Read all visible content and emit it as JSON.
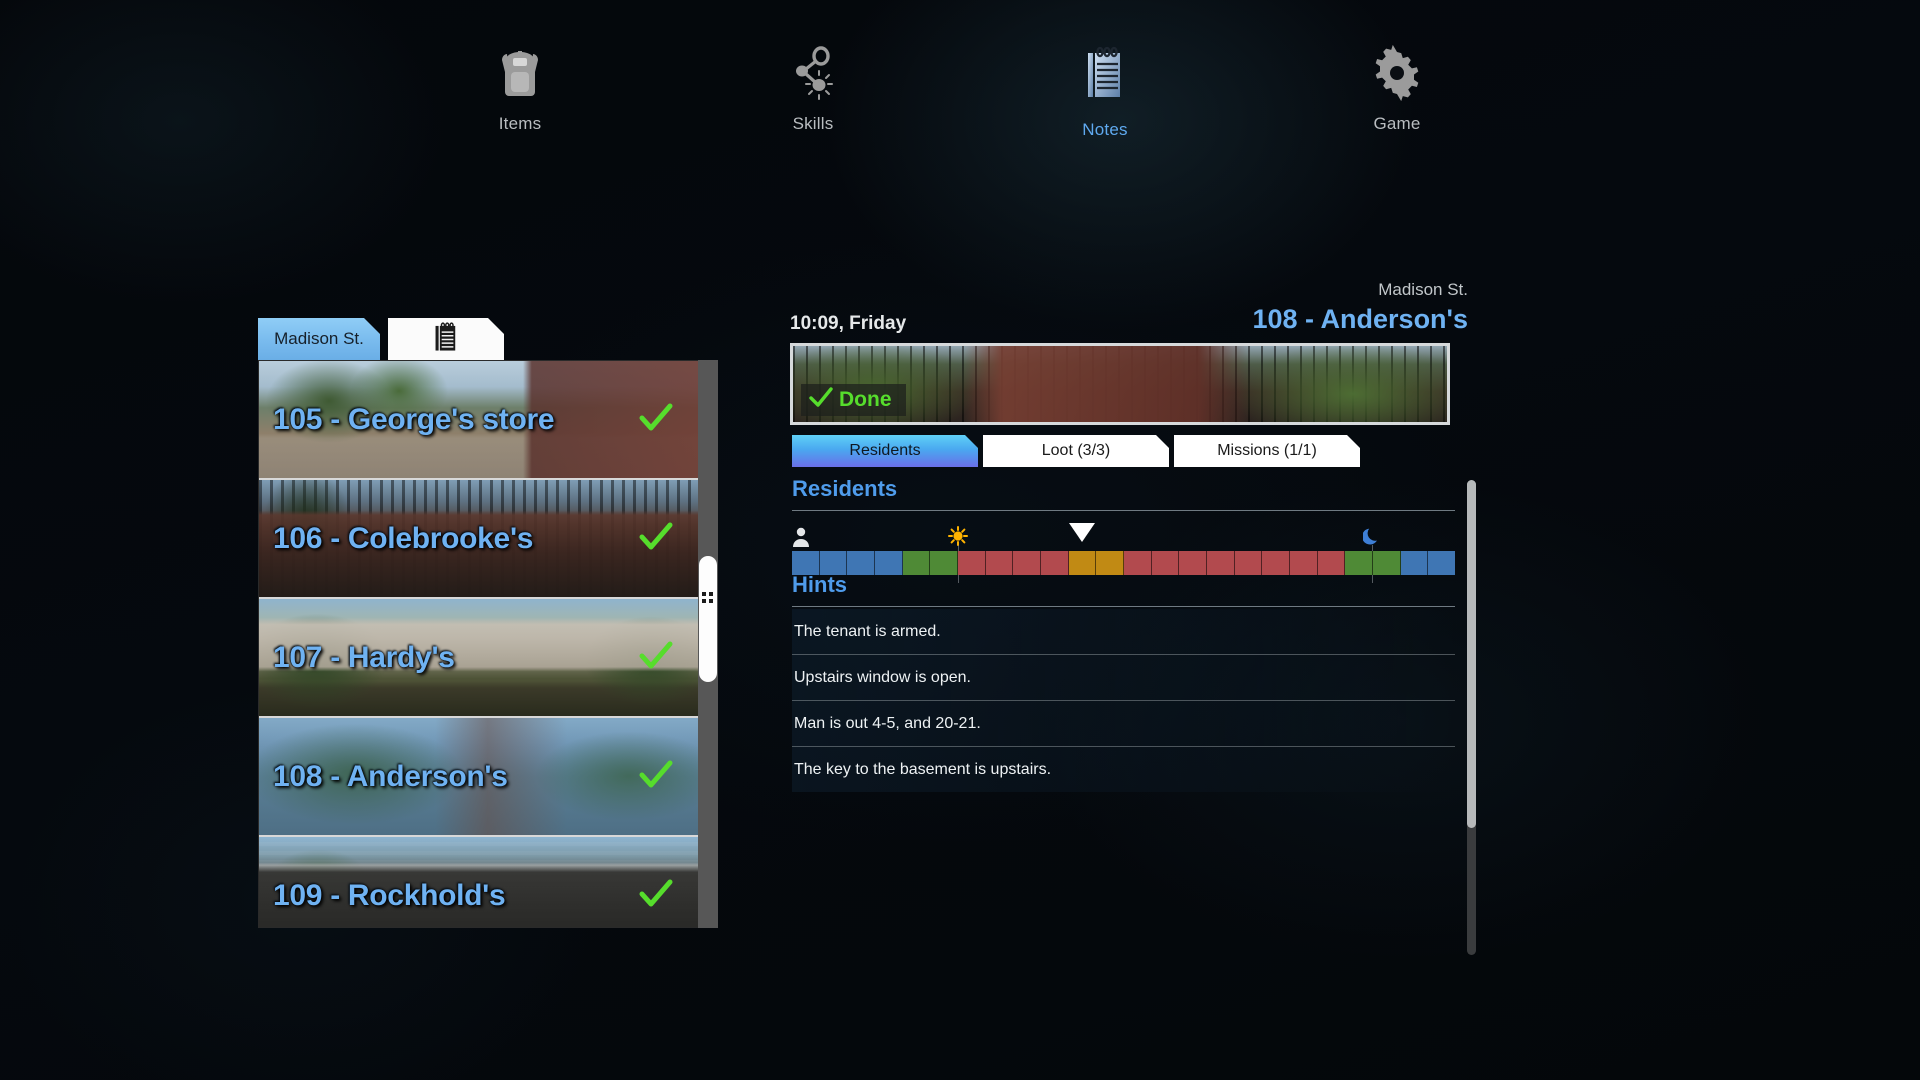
{
  "topnav": {
    "items": [
      {
        "id": "items",
        "label": "Items",
        "icon": "backpack-icon",
        "active": false
      },
      {
        "id": "skills",
        "label": "Skills",
        "icon": "skills-share-icon",
        "active": false
      },
      {
        "id": "notes",
        "label": "Notes",
        "icon": "notepad-icon",
        "active": true
      },
      {
        "id": "game",
        "label": "Game",
        "icon": "gear-icon",
        "active": false
      }
    ]
  },
  "left_panel": {
    "tabs": [
      {
        "id": "street-tab",
        "label": "Madison St.",
        "active": true
      },
      {
        "id": "notes-tab",
        "label": "",
        "icon": "notepad-icon",
        "active": false
      }
    ],
    "houses": [
      {
        "name": "105 - George's store",
        "done": true,
        "art": "th-store"
      },
      {
        "name": "106 - Colebrooke's",
        "done": true,
        "art": "th-cole"
      },
      {
        "name": "107 - Hardy's",
        "done": true,
        "art": "th-hardy"
      },
      {
        "name": "108 - Anderson's",
        "done": true,
        "art": "th-anderson"
      },
      {
        "name": "109 - Rockhold's",
        "done": true,
        "art": "th-rock"
      }
    ],
    "scrollbar": {
      "thumb_top_pct": 34,
      "thumb_height_pct": 22,
      "grip_icon": "resize-grip-icon"
    }
  },
  "right_panel": {
    "clock": "10:09, Friday",
    "location_street": "Madison St.",
    "location_title": "108 - Anderson's",
    "banner": {
      "status_label": "Done",
      "status_icon": "check-icon",
      "status_color": "#56dd2c"
    },
    "tabs": [
      {
        "id": "residents",
        "label": "Residents",
        "active": true
      },
      {
        "id": "loot",
        "label": "Loot (3/3)",
        "active": false
      },
      {
        "id": "missions",
        "label": "Missions (1/1)",
        "active": false
      }
    ],
    "residents": {
      "heading": "Residents",
      "timeline": {
        "person_icon": "person-icon",
        "sunrise_icon": "sun-icon",
        "sunset_icon": "moon-icon",
        "cursor_icon": "current-time-marker",
        "hours": 24,
        "sunrise_hour": 6,
        "sunset_hour": 21,
        "current_hour": 10,
        "colors": {
          "away": "#3f76b4",
          "transit": "#4f8a36",
          "home": "#b24a4e",
          "out": "#c18a14"
        },
        "segments": [
          "away",
          "away",
          "away",
          "away",
          "transit",
          "transit",
          "home",
          "home",
          "home",
          "home",
          "out",
          "out",
          "home",
          "home",
          "home",
          "home",
          "home",
          "home",
          "home",
          "home",
          "transit",
          "transit",
          "away",
          "away"
        ]
      }
    },
    "hints": {
      "heading": "Hints",
      "items": [
        "The tenant is armed.",
        "Upstairs window is open.",
        "Man is out 4-5, and 20-21.",
        "The key to the basement is upstairs."
      ]
    },
    "scrollbar": {
      "thumb_top_pct": 0,
      "thumb_height_pct": 73
    }
  }
}
